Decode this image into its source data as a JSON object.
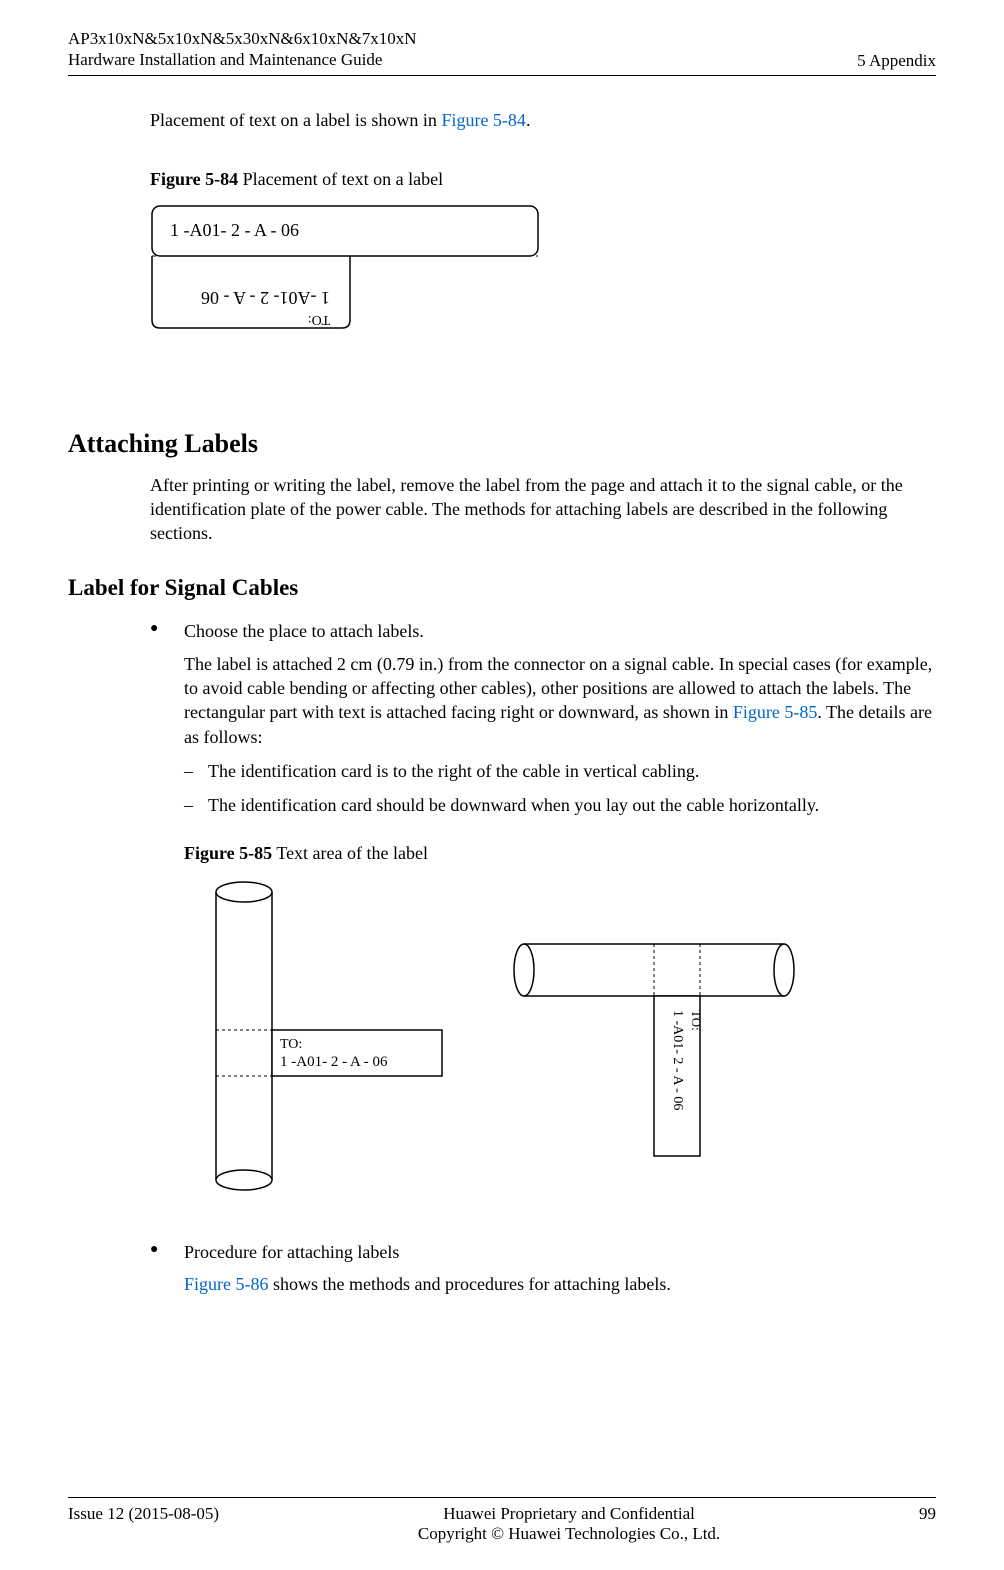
{
  "header": {
    "product_line1": "AP3x10xN&5x10xN&5x30xN&6x10xN&7x10xN",
    "product_line2": "Hardware Installation and Maintenance Guide",
    "section": "5 Appendix"
  },
  "intro_a": "Placement of text on a label is shown in ",
  "intro_link": "Figure 5-84",
  "intro_b": ".",
  "fig84_bold": "Figure 5-84",
  "fig84_rest": " Placement of text on a label",
  "label84_top": "1   -A01-  2  - A  - 06",
  "label84_to": "TO:",
  "h2_attaching": "Attaching Labels",
  "attaching_para": "After printing or writing the label, remove the label from the page and attach it to the signal cable, or the identification plate of the power cable. The methods for attaching labels are described in the following sections.",
  "h3_signal": "Label for Signal Cables",
  "bullet1_title": "Choose the place to attach labels.",
  "bullet1_body_a": "The label is attached 2 cm (0.79 in.) from the connector on a signal cable. In special cases (for example, to avoid cable bending or affecting other cables), other positions are allowed to attach the labels. The rectangular part with text is attached facing right or downward, as shown in ",
  "bullet1_body_link": "Figure 5-85",
  "bullet1_body_b": ". The details are as follows:",
  "dash1": "The identification card is to the right of the cable in vertical cabling.",
  "dash2": "The identification card should be downward when you lay out the cable horizontally.",
  "fig85_bold": "Figure 5-85",
  "fig85_rest": " Text area of the label",
  "label85_to": "TO:",
  "label85_line": "1   -A01-  2  - A  - 06",
  "bullet2_title": "Procedure for attaching labels",
  "bullet2_link": "Figure 5-86",
  "bullet2_rest": " shows the methods and procedures for attaching labels.",
  "footer": {
    "issue": "Issue 12 (2015-08-05)",
    "conf": "Huawei Proprietary and Confidential",
    "copy": "Copyright © Huawei Technologies Co., Ltd.",
    "page": "99"
  }
}
